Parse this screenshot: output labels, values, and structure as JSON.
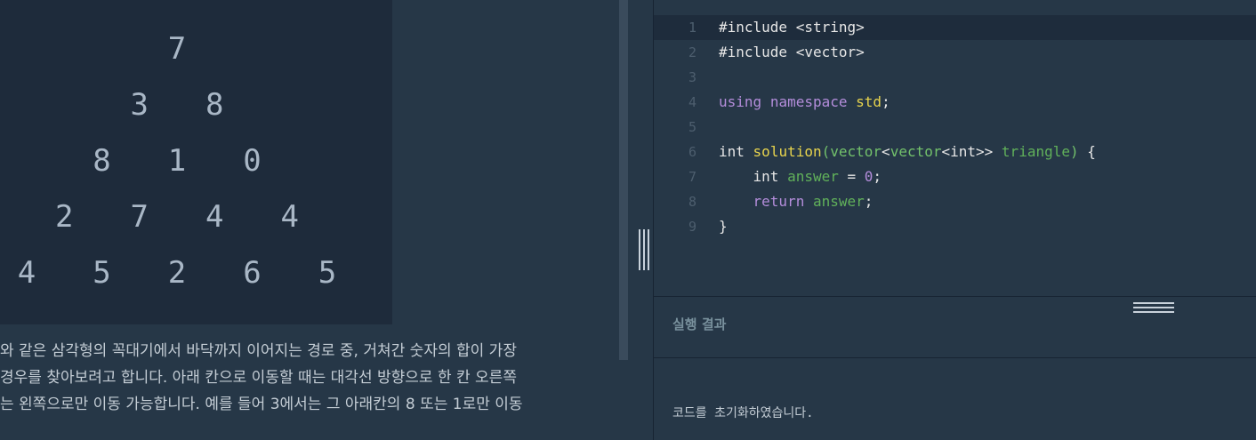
{
  "problem": {
    "triangle_rows": [
      [
        "7"
      ],
      [
        "3",
        "8"
      ],
      [
        "8",
        "1",
        "0"
      ],
      [
        "2",
        "7",
        "4",
        "4"
      ],
      [
        "4",
        "5",
        "2",
        "6",
        "5"
      ]
    ],
    "description_lines": [
      "와 같은 삼각형의 꼭대기에서 바닥까지 이어지는 경로 중, 거쳐간 숫자의 합이 가장",
      " 경우를 찾아보려고 합니다. 아래 칸으로 이동할 때는 대각선 방향으로 한 칸 오른쪽",
      "는 왼쪽으로만 이동 가능합니다. 예를 들어 3에서는 그 아래칸의 8 또는 1로만 이동"
    ]
  },
  "editor": {
    "lines": [
      {
        "num": "1",
        "tokens": [
          {
            "t": "#include <string>",
            "k": "pl"
          }
        ]
      },
      {
        "num": "2",
        "tokens": [
          {
            "t": "#include <vector>",
            "k": "pl"
          }
        ]
      },
      {
        "num": "3",
        "tokens": []
      },
      {
        "num": "4",
        "tokens": [
          {
            "t": "using",
            "k": "kw"
          },
          {
            "t": " ",
            "k": "pl"
          },
          {
            "t": "namespace",
            "k": "kw"
          },
          {
            "t": " ",
            "k": "pl"
          },
          {
            "t": "std",
            "k": "fn"
          },
          {
            "t": ";",
            "k": "pl"
          }
        ]
      },
      {
        "num": "5",
        "tokens": []
      },
      {
        "num": "6",
        "tokens": [
          {
            "t": "int",
            "k": "pl"
          },
          {
            "t": " ",
            "k": "pl"
          },
          {
            "t": "solution",
            "k": "fn"
          },
          {
            "t": "(",
            "k": "ty"
          },
          {
            "t": "vector",
            "k": "ty"
          },
          {
            "t": "<",
            "k": "pl"
          },
          {
            "t": "vector",
            "k": "ty"
          },
          {
            "t": "<int>>",
            "k": "pl"
          },
          {
            "t": " ",
            "k": "pl"
          },
          {
            "t": "triangle",
            "k": "id"
          },
          {
            "t": ")",
            "k": "ty"
          },
          {
            "t": " {",
            "k": "pl"
          }
        ]
      },
      {
        "num": "7",
        "tokens": [
          {
            "t": "    int",
            "k": "pl"
          },
          {
            "t": " ",
            "k": "pl"
          },
          {
            "t": "answer",
            "k": "id"
          },
          {
            "t": " = ",
            "k": "pl"
          },
          {
            "t": "0",
            "k": "num"
          },
          {
            "t": ";",
            "k": "pl"
          }
        ]
      },
      {
        "num": "8",
        "tokens": [
          {
            "t": "    ",
            "k": "pl"
          },
          {
            "t": "return",
            "k": "kw"
          },
          {
            "t": " ",
            "k": "pl"
          },
          {
            "t": "answer",
            "k": "id"
          },
          {
            "t": ";",
            "k": "pl"
          }
        ]
      },
      {
        "num": "9",
        "tokens": [
          {
            "t": "}",
            "k": "pl"
          }
        ]
      }
    ],
    "active_line": 1
  },
  "results": {
    "title": "실행 결과",
    "message": "코드를 초기화하였습니다."
  },
  "colors": {
    "background": "#263747",
    "triangle_box": "#1e2b3b",
    "keyword": "#b48ddb",
    "function": "#e8d44d",
    "type": "#73c16b"
  }
}
